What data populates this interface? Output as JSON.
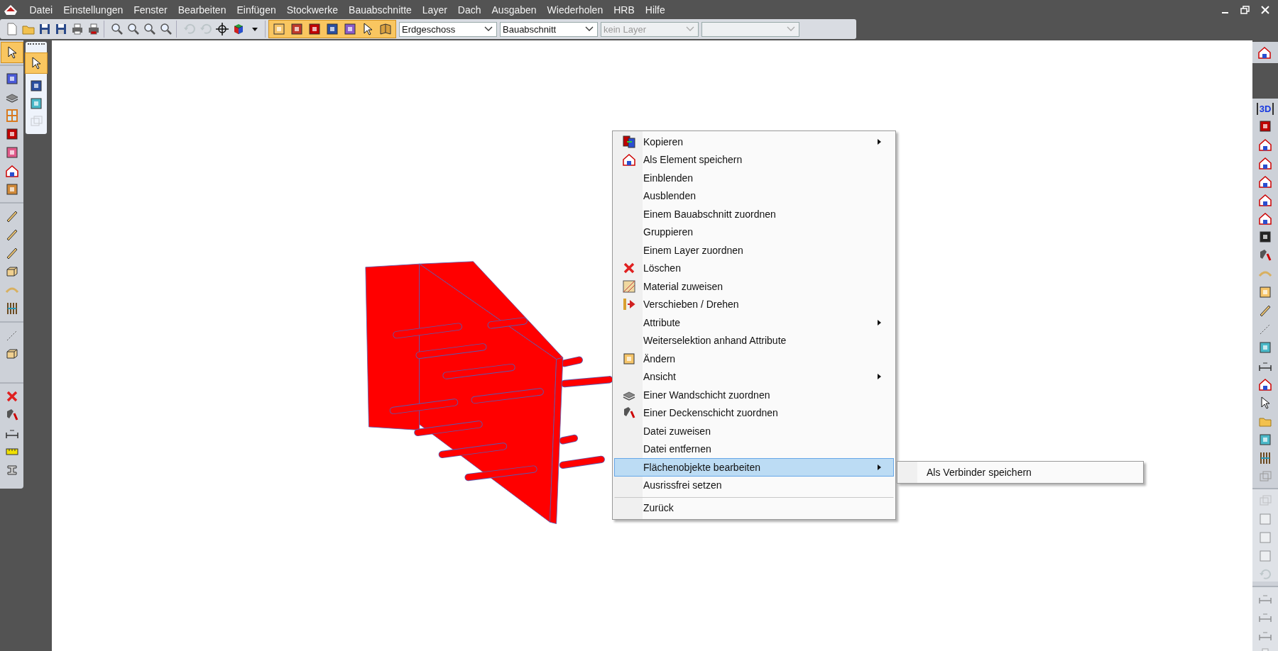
{
  "window": {
    "menu": [
      "Datei",
      "Einstellungen",
      "Fenster",
      "Bearbeiten",
      "Einfügen",
      "Stockwerke",
      "Bauabschnitte",
      "Layer",
      "Dach",
      "Ausgaben",
      "Wiederholen",
      "HRB",
      "Hilfe"
    ]
  },
  "toolbar": {
    "dropdowns": [
      {
        "value": "Erdgeschoss",
        "disabled": false
      },
      {
        "value": "Bauabschnitt",
        "disabled": false
      },
      {
        "value": "kein Layer",
        "disabled": true
      },
      {
        "disabled": true
      }
    ]
  },
  "right_toolbar": {
    "view_label": "3D"
  },
  "context_menu": {
    "items": [
      {
        "label": "Kopieren",
        "submenu": true,
        "selected": false,
        "separator_before": false
      },
      {
        "label": "Als Element speichern",
        "submenu": false,
        "selected": false,
        "separator_before": false
      },
      {
        "label": "Einblenden",
        "submenu": false,
        "selected": false,
        "separator_before": false
      },
      {
        "label": "Ausblenden",
        "submenu": false,
        "selected": false,
        "separator_before": false
      },
      {
        "label": "Einem Bauabschnitt zuordnen",
        "submenu": false,
        "selected": false,
        "separator_before": false
      },
      {
        "label": "Gruppieren",
        "submenu": false,
        "selected": false,
        "separator_before": false
      },
      {
        "label": "Einem Layer zuordnen",
        "submenu": false,
        "selected": false,
        "separator_before": false
      },
      {
        "label": "Löschen",
        "submenu": false,
        "selected": false,
        "separator_before": false
      },
      {
        "label": "Material zuweisen",
        "submenu": false,
        "selected": false,
        "separator_before": false
      },
      {
        "label": "Verschieben / Drehen",
        "submenu": false,
        "selected": false,
        "separator_before": false
      },
      {
        "label": "Attribute",
        "submenu": true,
        "selected": false,
        "separator_before": false
      },
      {
        "label": "Weiterselektion anhand Attribute",
        "submenu": false,
        "selected": false,
        "separator_before": false
      },
      {
        "label": "Ändern",
        "submenu": false,
        "selected": false,
        "separator_before": false
      },
      {
        "label": "Ansicht",
        "submenu": true,
        "selected": false,
        "separator_before": false
      },
      {
        "label": "Einer Wandschicht zuordnen",
        "submenu": false,
        "selected": false,
        "separator_before": false
      },
      {
        "label": "Einer Deckenschicht zuordnen",
        "submenu": false,
        "selected": false,
        "separator_before": false
      },
      {
        "label": "Datei zuweisen",
        "submenu": false,
        "selected": false,
        "separator_before": false
      },
      {
        "label": "Datei entfernen",
        "submenu": false,
        "selected": false,
        "separator_before": false
      },
      {
        "label": "Flächenobjekte bearbeiten",
        "submenu": true,
        "selected": true,
        "separator_before": false
      },
      {
        "label": "Ausrissfrei setzen",
        "submenu": false,
        "selected": false,
        "separator_before": false
      },
      {
        "label": "Zurück",
        "submenu": false,
        "selected": false,
        "separator_before": true
      }
    ]
  },
  "submenu": {
    "items": [
      {
        "label": "Als Verbinder speichern"
      }
    ]
  }
}
